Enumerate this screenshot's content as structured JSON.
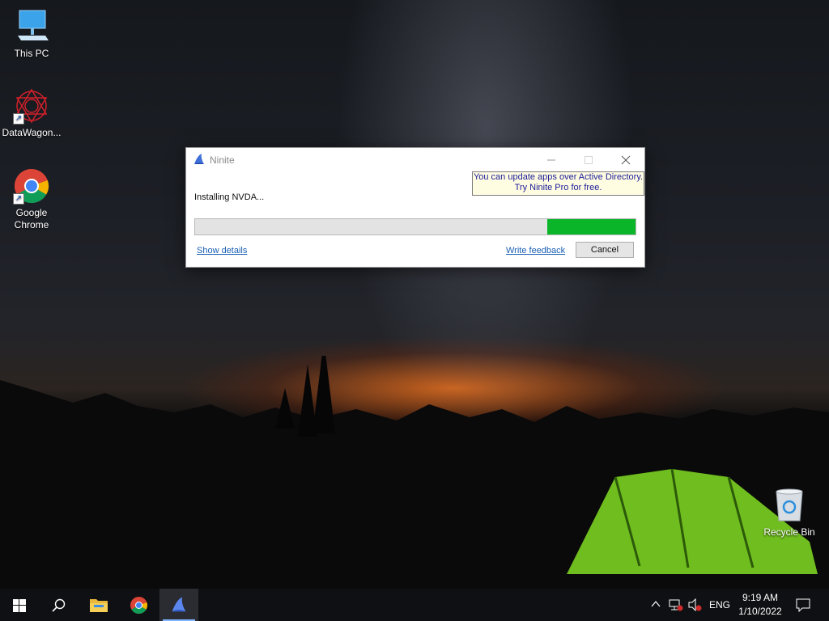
{
  "desktop": {
    "icons": [
      {
        "label": "This PC"
      },
      {
        "label": "DataWagon..."
      },
      {
        "label": "Google\nChrome"
      },
      {
        "label": "Recycle Bin"
      }
    ]
  },
  "window": {
    "title": "Ninite",
    "promo_line1": "You can update apps over Active Directory.",
    "promo_line2": "Try Ninite Pro for free.",
    "status": "Installing NVDA...",
    "progress": 0.2,
    "show_details": "Show details",
    "write_feedback": "Write feedback",
    "cancel": "Cancel",
    "colors": {
      "progress_fill": "#0bb529",
      "link": "#1a5fb4"
    }
  },
  "taskbar": {
    "language": "ENG",
    "time": "9:19 AM",
    "date": "1/10/2022",
    "icons": [
      "start-icon",
      "search-icon",
      "file-explorer-icon",
      "chrome-icon",
      "ninite-icon"
    ]
  }
}
